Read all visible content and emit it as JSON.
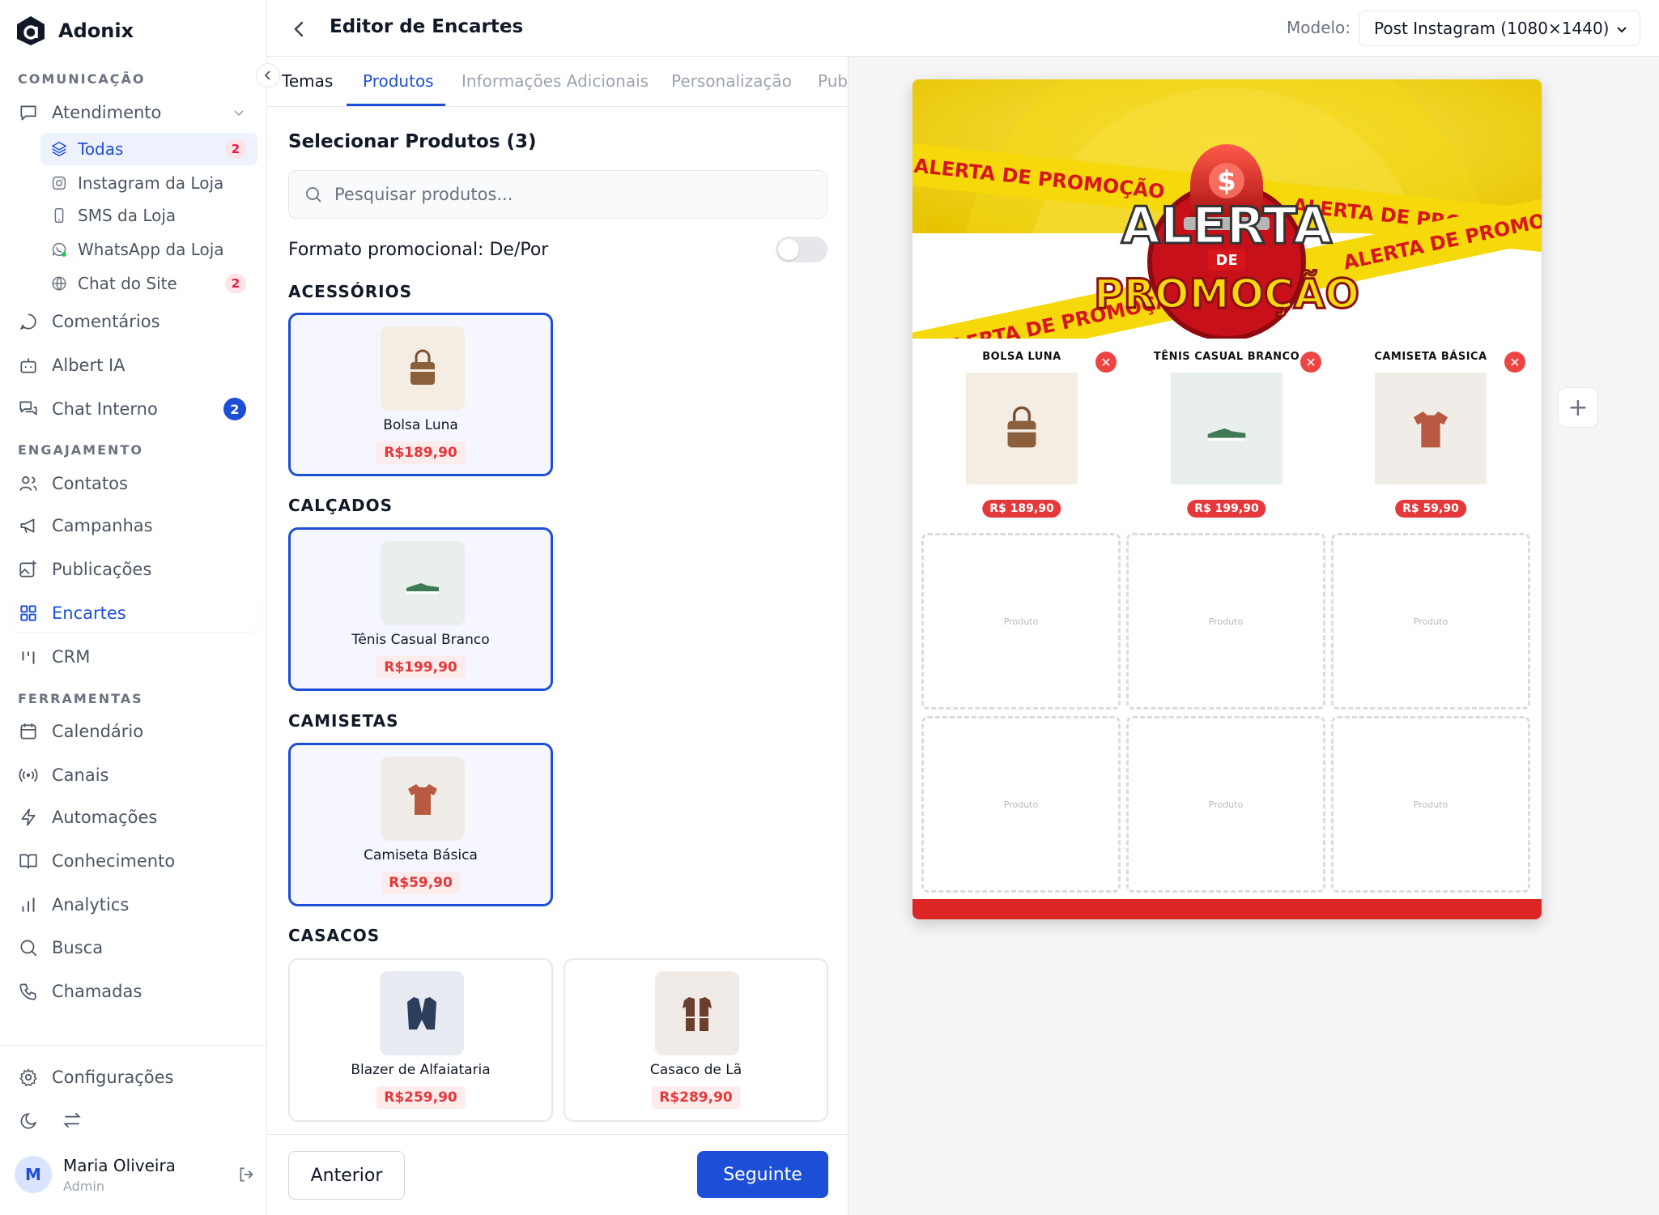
{
  "brand": {
    "name": "Adonix"
  },
  "sidebar": {
    "sections": {
      "comunicacao": "COMUNICAÇÃO",
      "engajamento": "ENGAJAMENTO",
      "ferramentas": "FERRAMENTAS"
    },
    "atendimento": {
      "label": "Atendimento",
      "children": [
        {
          "label": "Todas",
          "badge": "2"
        },
        {
          "label": "Instagram da Loja"
        },
        {
          "label": "SMS da Loja"
        },
        {
          "label": "WhatsApp da Loja"
        },
        {
          "label": "Chat do Site",
          "badge": "2"
        }
      ]
    },
    "items": [
      {
        "label": "Comentários"
      },
      {
        "label": "Albert IA"
      },
      {
        "label": "Chat Interno",
        "badge": "2"
      },
      {
        "label": "Contatos"
      },
      {
        "label": "Campanhas"
      },
      {
        "label": "Publicações"
      },
      {
        "label": "Encartes"
      },
      {
        "label": "CRM"
      },
      {
        "label": "Calendário"
      },
      {
        "label": "Canais"
      },
      {
        "label": "Automações"
      },
      {
        "label": "Conhecimento"
      },
      {
        "label": "Analytics"
      },
      {
        "label": "Busca"
      },
      {
        "label": "Chamadas"
      }
    ],
    "settings": "Configurações",
    "user": {
      "initial": "M",
      "name": "Maria Oliveira",
      "role": "Admin"
    }
  },
  "header": {
    "title": "Editor de Encartes",
    "model_label": "Modelo:",
    "model_value": "Post Instagram (1080×1440)"
  },
  "tabs": [
    {
      "label": "Temas"
    },
    {
      "label": "Produtos"
    },
    {
      "label": "Informações Adicionais"
    },
    {
      "label": "Personalização"
    },
    {
      "label": "Publ"
    }
  ],
  "products_panel": {
    "title": "Selecionar Produtos (3)",
    "search_placeholder": "Pesquisar produtos...",
    "promo_format_label": "Formato promocional: De/Por",
    "promo_format_on": false,
    "categories": [
      {
        "name": "ACESSÓRIOS",
        "products": [
          {
            "name": "Bolsa Luna",
            "price": "R$189,90",
            "selected": true,
            "icon": "bag-icon"
          }
        ]
      },
      {
        "name": "CALÇADOS",
        "products": [
          {
            "name": "Tênis Casual Branco",
            "price": "R$199,90",
            "selected": true,
            "icon": "sneaker-icon"
          }
        ]
      },
      {
        "name": "CAMISETAS",
        "products": [
          {
            "name": "Camiseta Básica",
            "price": "R$59,90",
            "selected": true,
            "icon": "tshirt-icon"
          }
        ]
      },
      {
        "name": "CASACOS",
        "products": [
          {
            "name": "Blazer de Alfaiataria",
            "price": "R$259,90",
            "selected": false,
            "icon": "blazer-icon"
          },
          {
            "name": "Casaco de Lã",
            "price": "R$289,90",
            "selected": false,
            "icon": "coat-icon"
          }
        ]
      }
    ]
  },
  "footer": {
    "prev": "Anterior",
    "next": "Seguinte"
  },
  "poster": {
    "tape_text": "ALERTA DE PROMOÇÃO",
    "headline_top": "ALERTA",
    "headline_mid": "DE",
    "headline_bottom": "PROMOÇÃO",
    "products": [
      {
        "name": "BOLSA LUNA",
        "price": "R$ 189,90"
      },
      {
        "name": "TÊNIS CASUAL BRANCO",
        "price": "R$ 199,90"
      },
      {
        "name": "CAMISETA BÁSICA",
        "price": "R$ 59,90"
      }
    ],
    "placeholder_label": "Produto",
    "colors": {
      "yellow": "#f5d90a",
      "red": "#dc2626",
      "blue": "#1d4ed8"
    }
  }
}
